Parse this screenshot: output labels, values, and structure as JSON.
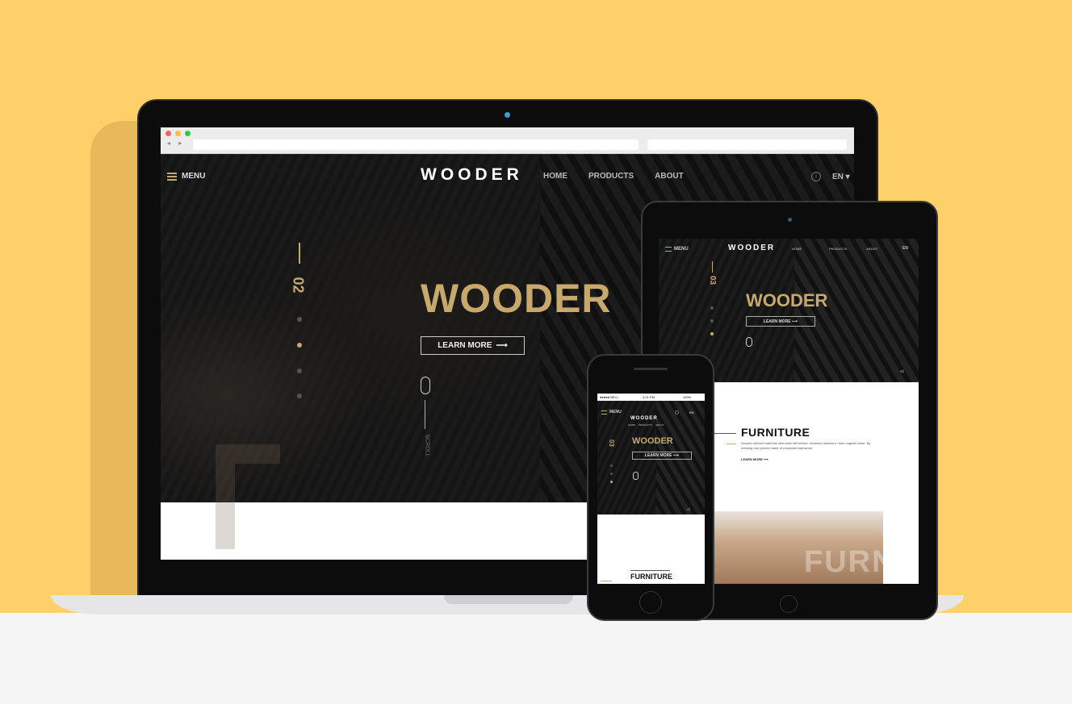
{
  "desktop": {
    "menu_label": "MENU",
    "logo": "WOODER",
    "nav": [
      "HOME",
      "PRODUCTS",
      "ABOUT"
    ],
    "lang": "EN",
    "slide_number": "02",
    "hero_title": "WOODER",
    "cta": "LEARN MORE",
    "scroll_label": "SCROLL"
  },
  "tablet": {
    "menu_label": "MENU",
    "logo": "WOODER",
    "nav": [
      "HOME",
      "PRODUCTS",
      "ABOUT"
    ],
    "lang": "EN",
    "slide_number": "03",
    "hero_title": "WOODER",
    "cta": "LEARN MORE",
    "section_title": "FURNITURE",
    "section_text": "Wooder utilizes materials otherwise left behind, rendered useless in their original intent. By creating new pieces made of reclaimed barnwood",
    "section_link": "LEARN MORE",
    "photo_overlay": "FURNIT"
  },
  "phone": {
    "status": {
      "carrier": "●●●●● BELL",
      "time": "4:21 PM",
      "battery": "100%"
    },
    "menu_label": "MENU",
    "logo": "WOODER",
    "nav": [
      "HOME",
      "PRODUCTS",
      "ABOUT"
    ],
    "lang": "EN",
    "slide_number": "03",
    "hero_title": "WOODER",
    "cta": "LEARN MORE",
    "section_title": "FURNITURE"
  },
  "colors": {
    "background": "#fdd06a",
    "accent_gold": "#c7a96b",
    "dark": "#131313"
  }
}
